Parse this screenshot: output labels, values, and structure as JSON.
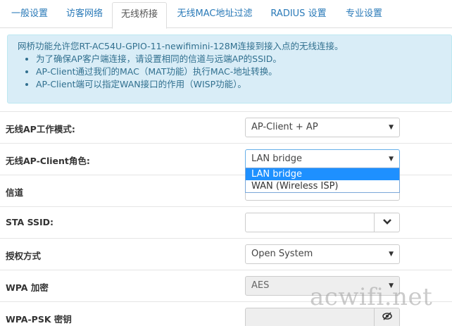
{
  "tabs": [
    {
      "label": "一般设置"
    },
    {
      "label": "访客网络"
    },
    {
      "label": "无线桥接"
    },
    {
      "label": "无线MAC地址过滤"
    },
    {
      "label": "RADIUS 设置"
    },
    {
      "label": "专业设置"
    }
  ],
  "info": {
    "intro": "网桥功能允许您RT-AC54U-GPIO-11-newifimini-128M连接到接入点的无线连接。",
    "bullets": [
      "为了确保AP客户端连接，请设置相同的信道与远端AP的SSID。",
      "AP-Client通过我们的MAC（MAT功能）执行MAC-地址转换。",
      "AP-Client端可以指定WAN接口的作用（WISP功能）。"
    ]
  },
  "form": {
    "mode": {
      "label": "无线AP工作模式:",
      "value": "AP-Client + AP"
    },
    "role": {
      "label": "无线AP-Client角色:",
      "value": "LAN bridge",
      "options": [
        "LAN bridge",
        "WAN (Wireless ISP)"
      ]
    },
    "channel": {
      "label": "信道"
    },
    "ssid": {
      "label": "STA SSID:",
      "value": ""
    },
    "auth": {
      "label": "授权方式",
      "value": "Open System"
    },
    "wpa": {
      "label": "WPA 加密",
      "value": "AES"
    },
    "psk": {
      "label": "WPA-PSK 密钥",
      "value": ""
    }
  },
  "watermark": "acwifi.net",
  "icons": {
    "caret": "caret-down-icon",
    "chevron": "chevron-down-icon",
    "eye": "eye-slash-icon"
  },
  "colors": {
    "accent": "#2a7ab8",
    "info_bg": "#d9edf7",
    "info_text": "#31708f",
    "selected_option": "#1e90ff"
  }
}
